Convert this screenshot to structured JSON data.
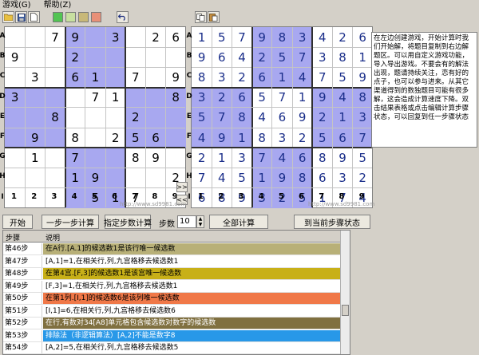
{
  "menu": [
    "游戏(G)",
    "帮助(Z)"
  ],
  "toolbar": {
    "icons": [
      "open-folder-icon",
      "save-icon",
      "new-document-icon"
    ],
    "colors": [
      "#52c452",
      "#c8e0a0",
      "#c8b878",
      "#e89078"
    ],
    "undo_icon": "undo-icon",
    "right_icons": [
      "copy-icon",
      "paste-icon"
    ]
  },
  "row_labels": [
    "A",
    "B",
    "C",
    "D",
    "E",
    "F",
    "G",
    "H",
    "I"
  ],
  "col_labels": [
    "1",
    "2",
    "3",
    "4",
    "5",
    "6",
    "7",
    "8",
    "9"
  ],
  "left_board": [
    [
      "",
      "",
      "7",
      "9",
      "",
      "3",
      "",
      "2",
      "6"
    ],
    [
      "9",
      "",
      "",
      "2",
      "",
      "",
      "",
      "",
      ""
    ],
    [
      "",
      "3",
      "",
      "6",
      "1",
      "",
      "7",
      "",
      "9"
    ],
    [
      "3",
      "",
      "",
      "",
      "7",
      "1",
      "",
      "",
      "8"
    ],
    [
      "",
      "",
      "8",
      "",
      "",
      "",
      "2",
      "",
      ""
    ],
    [
      "",
      "9",
      "",
      "8",
      "",
      "2",
      "5",
      "6",
      ""
    ],
    [
      "",
      "1",
      "",
      "7",
      "",
      "",
      "8",
      "9",
      ""
    ],
    [
      "",
      "",
      "",
      "1",
      "9",
      "",
      "",
      "",
      "2"
    ],
    [
      "",
      "",
      "",
      "",
      "5",
      "1",
      "7",
      "",
      ""
    ]
  ],
  "right_board": [
    [
      "1",
      "5",
      "7",
      "9",
      "8",
      "3",
      "4",
      "2",
      "6"
    ],
    [
      "9",
      "6",
      "4",
      "2",
      "5",
      "7",
      "3",
      "8",
      "1"
    ],
    [
      "8",
      "3",
      "2",
      "6",
      "1",
      "4",
      "7",
      "5",
      "9"
    ],
    [
      "3",
      "2",
      "6",
      "5",
      "7",
      "1",
      "9",
      "4",
      "8"
    ],
    [
      "5",
      "7",
      "8",
      "4",
      "6",
      "9",
      "2",
      "1",
      "3"
    ],
    [
      "4",
      "9",
      "1",
      "8",
      "3",
      "2",
      "5",
      "6",
      "7"
    ],
    [
      "2",
      "1",
      "3",
      "7",
      "4",
      "6",
      "8",
      "9",
      "5"
    ],
    [
      "7",
      "4",
      "5",
      "1",
      "9",
      "8",
      "6",
      "3",
      "2"
    ],
    [
      "6",
      "8",
      "9",
      "3",
      "2",
      "5",
      "1",
      "7",
      "4"
    ]
  ],
  "watermark": "http://www.sd9981.com",
  "copy_arrow": ">>",
  "back_arrow": "<<",
  "help_text": "在左边创建游戏，开始计算时我们开始解，将题目复制到右边解题区。可以用自定义游戏功能，导入导出游戏。不要会有的解法出现，题请持续关注，恋有好的点子，也可以参与进来。从其它渠道得到的数独题目可能有很多解，这会造成计算速度下降。双击结果表格或点击编辑计算步骤状态，可以回复到任一步骤状态",
  "buttons": {
    "start": "开始",
    "step_by_step": "一步一步计算",
    "specified_steps": "指定步数计算",
    "steps_label": "步数",
    "steps_value": "10",
    "full_calc": "全部计算",
    "goto_state": "到当前步骤状态"
  },
  "log": {
    "col_step": "步骤",
    "col_desc": "说明",
    "rows": [
      {
        "step": "第46步",
        "desc": "在A行.[A.1]的候选数1是该行唯一候选数",
        "color": "#b8b078"
      },
      {
        "step": "第47步",
        "desc": "[A,1]=1,在相关行,列,九宫格移去候选数1",
        "color": "#ffffff"
      },
      {
        "step": "第48步",
        "desc": "在第4宫.[F,3]的候选数1是该宫唯一候选数",
        "color": "#c8b018"
      },
      {
        "step": "第49步",
        "desc": "[F,3]=1,在相关行,列,九宫格移去候选数1",
        "color": "#ffffff"
      },
      {
        "step": "第50步",
        "desc": "在第1列.[I,1]的候选数6是该列唯一候选数",
        "color": "#f07848"
      },
      {
        "step": "第51步",
        "desc": "[I,1]=6,在相关行,列,九宫格移去候选数6",
        "color": "#ffffff"
      },
      {
        "step": "第52步",
        "desc": "在行,有数对34[A8]单元格包含候选数对数字的候选数",
        "color": "#807040"
      },
      {
        "step": "第53步",
        "desc": "排除法（非逻辑算法）[A,2]不能是数字8",
        "color": "#2898e8"
      },
      {
        "step": "第54步",
        "desc": "[A,2]=5,在相关行,列,九宫格移去候选数5",
        "color": "#ffffff"
      }
    ]
  }
}
